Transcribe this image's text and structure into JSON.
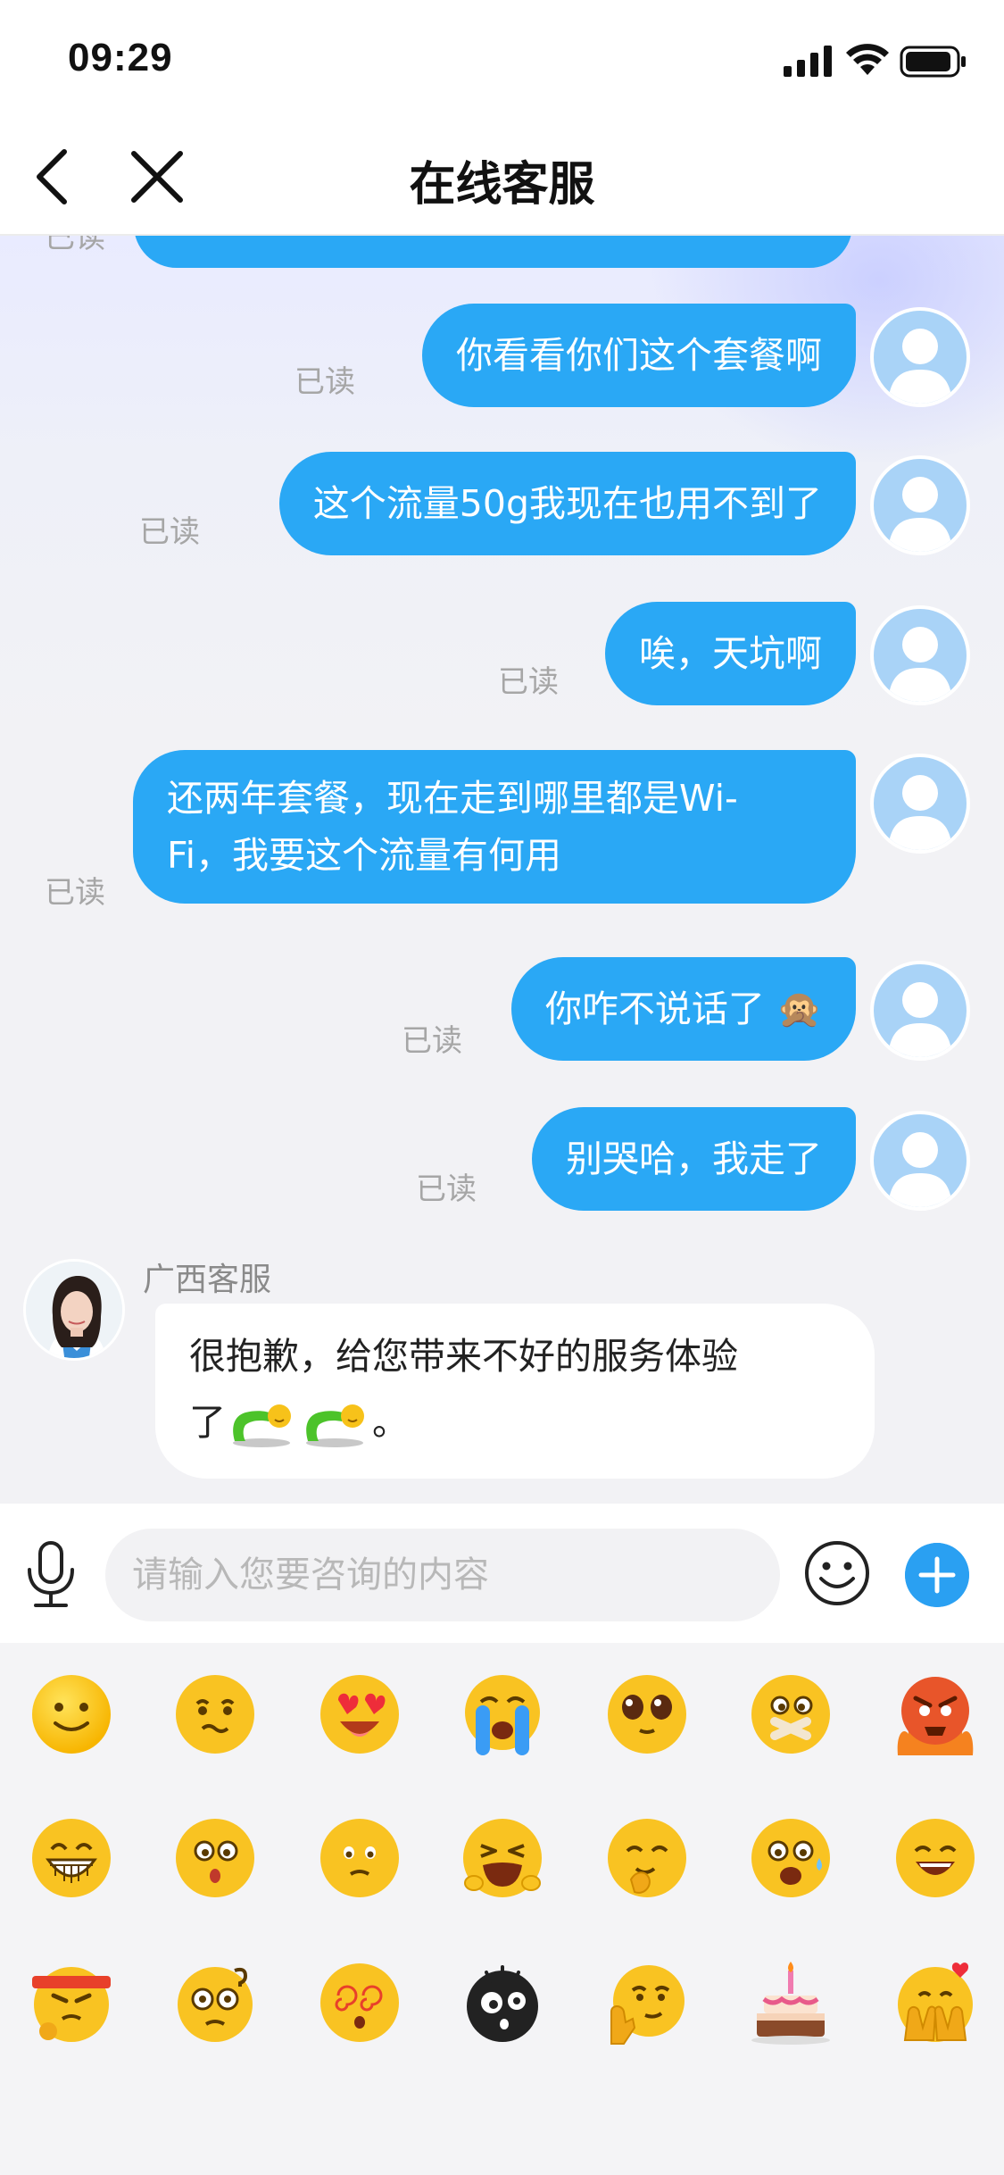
{
  "status_bar": {
    "time": "09:29"
  },
  "nav": {
    "title": "在线客服"
  },
  "chat": {
    "partial_read": "已读",
    "messages_out": [
      {
        "text": "你看看你们这个套餐啊",
        "read": "已读"
      },
      {
        "text": "这个流量50g我现在也用不到了",
        "read": "已读"
      },
      {
        "text": "唉，天坑啊",
        "read": "已读"
      },
      {
        "line1": "还两年套餐，现在走到哪里都是Wi-",
        "line2": "Fi，我要这个流量有何用",
        "read": "已读"
      },
      {
        "text": "你咋不说话了",
        "emoji": "🙊",
        "read": "已读"
      },
      {
        "text": "别哭哈，我走了",
        "read": "已读"
      }
    ],
    "agent": {
      "name": "广西客服",
      "line1": "很抱歉，给您带来不好的服务体验",
      "line2_prefix": "了",
      "line2_suffix": "。"
    }
  },
  "input": {
    "placeholder": "请输入您要咨询的内容"
  },
  "emoji_panel": {
    "rows": [
      [
        "smile-emoji",
        "awkward-emoji",
        "heart-eyes-emoji",
        "crying-emoji",
        "shy-eyes-emoji",
        "shush-emoji",
        "angry-fire-emoji"
      ],
      [
        "grin-emoji",
        "surprised-emoji",
        "pout-emoji",
        "wail-emoji",
        "chuckle-emoji",
        "sweat-emoji",
        "happy-emoji"
      ],
      [
        "determined-emoji",
        "confused-emoji",
        "dizzy-emoji",
        "black-ghost-emoji",
        "thinking-emoji",
        "birthday-cake-emoji",
        "cover-face-emoji"
      ]
    ]
  },
  "colors": {
    "accent": "#2aa8f5",
    "bubble_in": "#ffffff",
    "background": "#f2f2f5"
  }
}
